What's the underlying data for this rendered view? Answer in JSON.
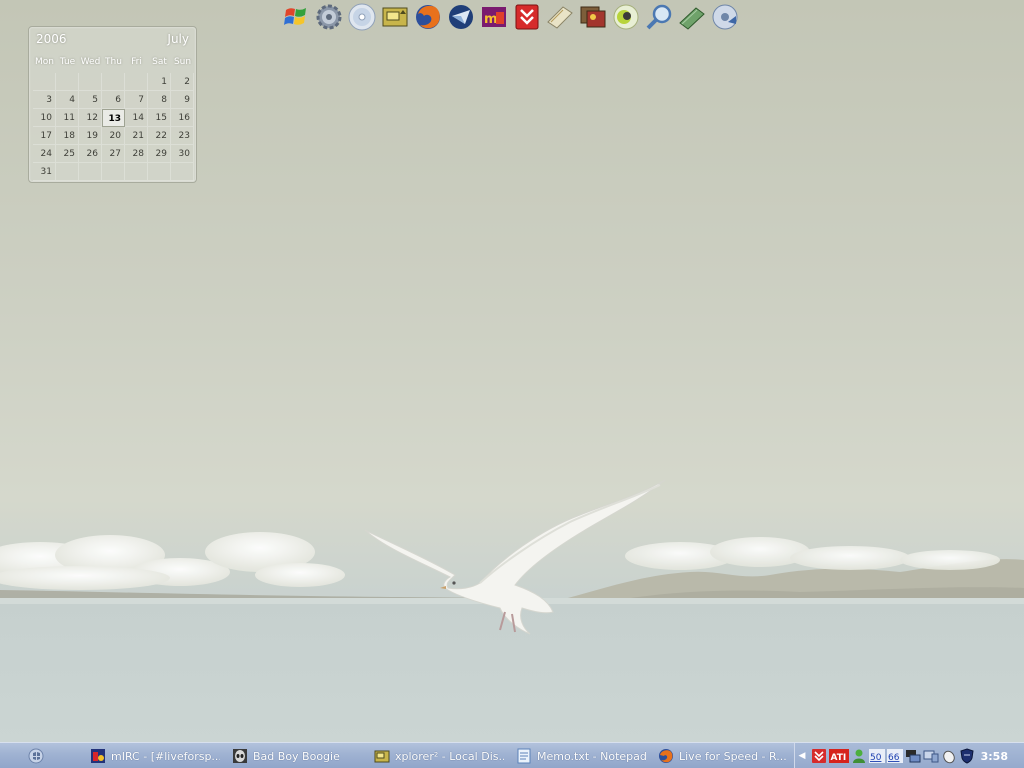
{
  "dock": {
    "icons": [
      {
        "name": "windows-flag-icon"
      },
      {
        "name": "gear-icon"
      },
      {
        "name": "cd-disc-icon"
      },
      {
        "name": "folder-switch-icon"
      },
      {
        "name": "firefox-icon"
      },
      {
        "name": "thunderbird-icon"
      },
      {
        "name": "mirc-icon"
      },
      {
        "name": "download-arrows-icon"
      },
      {
        "name": "notepad-book-icon"
      },
      {
        "name": "photos-icon"
      },
      {
        "name": "media-player-icon"
      },
      {
        "name": "magnifier-icon"
      },
      {
        "name": "green-book-icon"
      },
      {
        "name": "disc-burner-icon"
      }
    ]
  },
  "calendar": {
    "year": "2006",
    "month": "July",
    "day_names": [
      "Mon",
      "Tue",
      "Wed",
      "Thu",
      "Fri",
      "Sat",
      "Sun"
    ],
    "weeks": [
      [
        "",
        "",
        "",
        "",
        "",
        "1",
        "2"
      ],
      [
        "3",
        "4",
        "5",
        "6",
        "7",
        "8",
        "9"
      ],
      [
        "10",
        "11",
        "12",
        "13",
        "14",
        "15",
        "16"
      ],
      [
        "17",
        "18",
        "19",
        "20",
        "21",
        "22",
        "23"
      ],
      [
        "24",
        "25",
        "26",
        "27",
        "28",
        "29",
        "30"
      ],
      [
        "31",
        "",
        "",
        "",
        "",
        "",
        ""
      ]
    ],
    "today": "13"
  },
  "taskbar": {
    "tasks": [
      {
        "label": "mIRC - [#liveforsp...",
        "icon": "mirc-icon"
      },
      {
        "label": "Bad Boy Boogie",
        "icon": "alien-icon"
      },
      {
        "label": "xplorer² - Local Dis...",
        "icon": "folder-switch-icon"
      },
      {
        "label": "Memo.txt - Notepad",
        "icon": "notepad-icon"
      },
      {
        "label": "Live for Speed - R...",
        "icon": "firefox-icon"
      }
    ],
    "tray": {
      "icons": [
        "download-arrows-icon",
        "ati-icon",
        "messenger-icon",
        "volume-50-icon",
        "volume-66-icon",
        "network-icon",
        "computer-icon",
        "mouse-icon",
        "shield-icon"
      ],
      "tray_text_1": "50",
      "tray_text_2": "66",
      "ati_label": "ATI"
    },
    "clock": "3:58"
  },
  "colors": {
    "taskbar": "#9fb2d2",
    "desktop": "#cdd0c3",
    "water": "#c5cfce"
  }
}
